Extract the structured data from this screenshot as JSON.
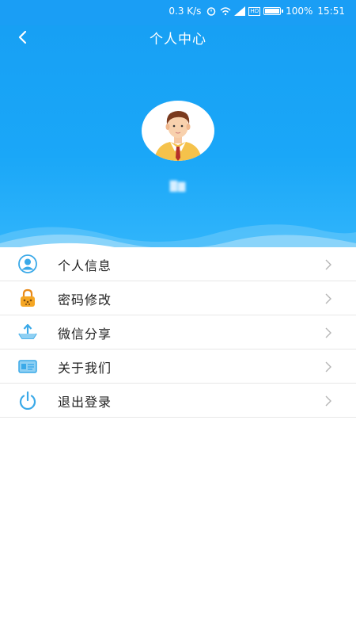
{
  "status_bar": {
    "speed": "0.3 K/s",
    "network_hd": "HD",
    "battery": "100%",
    "time": "15:51",
    "battery_level": 1.0
  },
  "nav": {
    "title": "个人中心",
    "back_icon": "chevron-left-icon"
  },
  "profile": {
    "username": "█▇",
    "avatar_icon": "user-avatar-icon"
  },
  "menu": {
    "items": [
      {
        "label": "个人信息",
        "icon": "person-icon"
      },
      {
        "label": "密码修改",
        "icon": "lock-icon"
      },
      {
        "label": "微信分享",
        "icon": "share-icon"
      },
      {
        "label": "关于我们",
        "icon": "id-card-icon"
      },
      {
        "label": "退出登录",
        "icon": "power-icon"
      }
    ],
    "chevron_icon": "chevron-right-icon"
  },
  "colors": {
    "header_blue": "#1aa7f8",
    "icon_blue": "#3aa9e8",
    "lock_orange": "#e88a1a"
  }
}
